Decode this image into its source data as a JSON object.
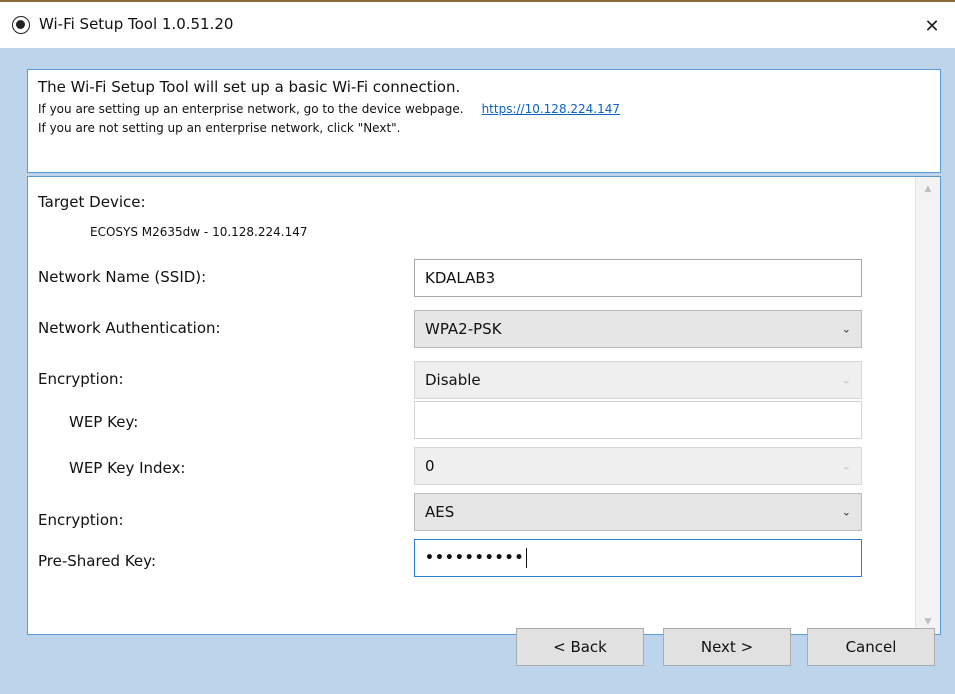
{
  "window": {
    "title": "Wi-Fi Setup Tool 1.0.51.20",
    "close_glyph": "✕"
  },
  "intro": {
    "heading": "The Wi-Fi Setup Tool will set up a basic Wi-Fi connection.",
    "line2": "If you are setting up an enterprise network, go to the device webpage.",
    "link": "https://10.128.224.147",
    "line3": "If you are not setting up an enterprise network, click \"Next\"."
  },
  "settings": {
    "target_device_label": "Target Device:",
    "target_device_value": "ECOSYS M2635dw - 10.128.224.147",
    "ssid_label": "Network Name (SSID):",
    "ssid_value": "KDALAB3",
    "auth_label": "Network Authentication:",
    "auth_value": "WPA2-PSK",
    "encryption1_label": "Encryption:",
    "encryption1_value": "Disable",
    "wep_key_label": "WEP Key:",
    "wep_key_value": "",
    "wep_index_label": "WEP Key Index:",
    "wep_index_value": "0",
    "encryption2_label": "Encryption:",
    "encryption2_value": "AES",
    "psk_label": "Pre-Shared Key:",
    "psk_value": "••••••••••"
  },
  "buttons": {
    "back": "< Back",
    "next": "Next >",
    "cancel": "Cancel"
  },
  "icons": {
    "caret": "chevron-down-icon",
    "scroll_up": "scroll-up-icon",
    "scroll_down": "scroll-down-icon"
  }
}
